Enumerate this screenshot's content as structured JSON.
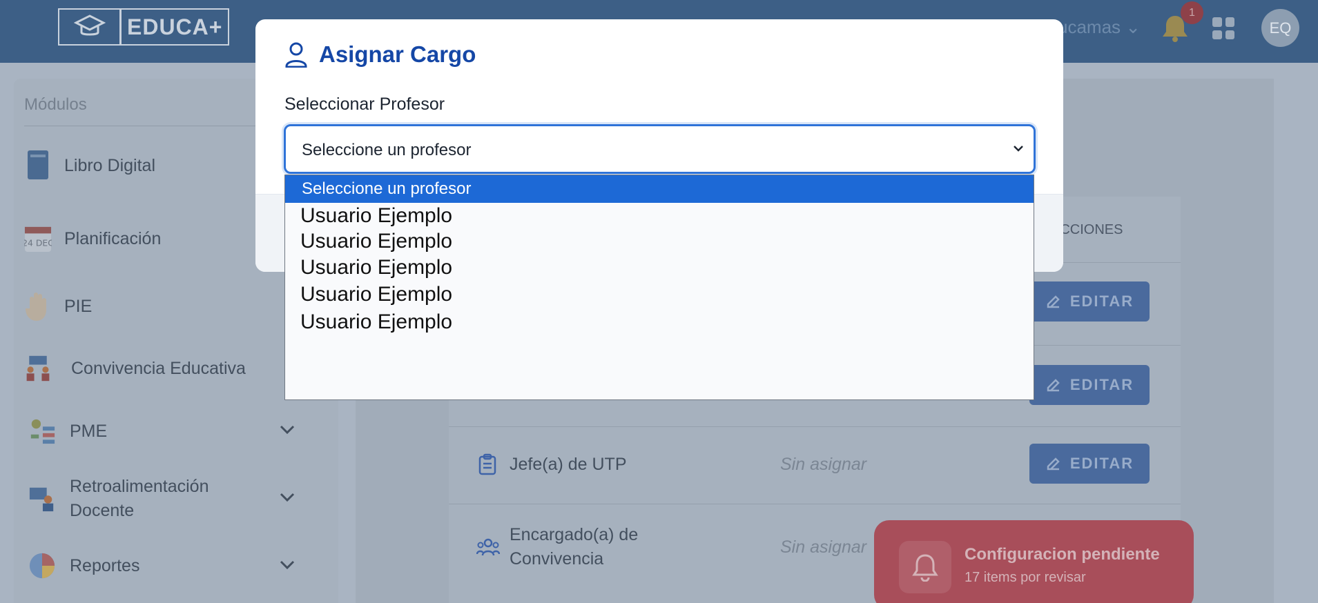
{
  "header": {
    "logo_text": "EDUCA+",
    "user_menu_label": "ucamas",
    "notification_count": "1",
    "avatar_initials": "EQ"
  },
  "sidebar": {
    "title": "Módulos",
    "items": [
      {
        "label": "Libro Digital",
        "icon": "book-icon"
      },
      {
        "label": "Planificación",
        "icon": "calendar-icon",
        "icon_text": "24 DEC"
      },
      {
        "label": "PIE",
        "icon": "hand-icon"
      },
      {
        "label": "Convivencia Educativa",
        "icon": "people-board-icon"
      },
      {
        "label": "PME",
        "icon": "gear-list-icon",
        "expandable": true
      },
      {
        "label": "Retroalimentación Docente",
        "icon": "teacher-icon",
        "expandable": true
      },
      {
        "label": "Reportes",
        "icon": "pie-chart-icon",
        "expandable": true
      }
    ]
  },
  "roles_table": {
    "actions_header": "ACCIONES",
    "edit_label": "EDITAR",
    "rows": [
      {
        "label": "",
        "value": ""
      },
      {
        "label": "",
        "value": ""
      },
      {
        "label": "Jefe(a) de UTP",
        "value": "Sin asignar"
      },
      {
        "label": "Encargado(a) de Convivencia",
        "value": "Sin asignar"
      }
    ]
  },
  "toast": {
    "title": "Configuracion pendiente",
    "subtitle": "17 items por revisar"
  },
  "modal": {
    "title": "Asignar Cargo",
    "field_label": "Seleccionar Profesor",
    "select_value": "Seleccione un profesor",
    "options": [
      "Seleccione un profesor",
      "Usuario Ejemplo",
      "Usuario Ejemplo",
      "Usuario Ejemplo",
      "Usuario Ejemplo",
      "Usuario Ejemplo"
    ],
    "selected_index": 0
  },
  "colors": {
    "accent": "#1547a6",
    "focus": "#2f73d8",
    "selected_option": "#1d69d6",
    "toast": "#a84e5a"
  }
}
